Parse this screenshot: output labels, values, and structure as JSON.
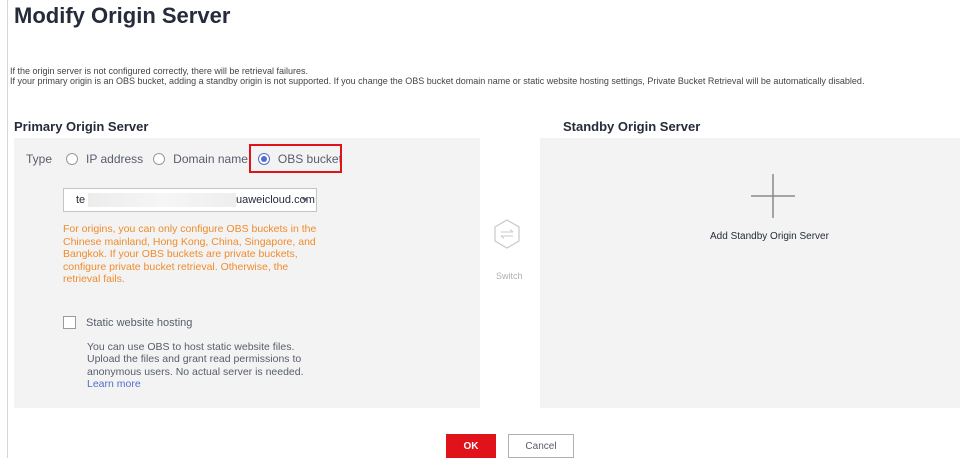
{
  "dialog": {
    "title": "Modify Origin Server",
    "notice_line1": "If the origin server is not configured correctly, there will be retrieval failures.",
    "notice_line2": "If your primary origin is an OBS bucket, adding a standby origin is not supported. If you change the OBS bucket domain name or static website hosting settings, Private Bucket Retrieval will be automatically disabled."
  },
  "primary": {
    "heading": "Primary Origin Server",
    "type_label": "Type",
    "type_options": [
      {
        "label": "IP address",
        "selected": false
      },
      {
        "label": "Domain name",
        "selected": false
      },
      {
        "label": "OBS bucket",
        "selected": true
      }
    ],
    "bucket_select": {
      "prefix": "te",
      "suffix": "uaweicloud.com"
    },
    "warning": "For origins, you can only configure OBS buckets in the Chinese mainland, Hong Kong, China, Singapore, and Bangkok. If your OBS buckets are private buckets, configure private bucket retrieval. Otherwise, the retrieval fails.",
    "static_hosting": {
      "label": "Static website hosting",
      "checked": false,
      "description": "You can use OBS to host static website files. Upload the files and grant read permissions to anonymous users. No actual server is needed.",
      "link": "Learn more"
    }
  },
  "switch": {
    "label": "Switch",
    "icon": "switch-arrows-icon"
  },
  "standby": {
    "heading": "Standby Origin Server",
    "add_label": "Add Standby Origin Server",
    "icon": "plus-icon"
  },
  "footer": {
    "ok_label": "OK",
    "cancel_label": "Cancel"
  },
  "colors": {
    "primary_button": "#e0121a",
    "radio_selected": "#526ecc",
    "warning_text": "#f08c2c",
    "highlight_box": "#e0121a",
    "panel_bg": "#f3f3f3"
  }
}
